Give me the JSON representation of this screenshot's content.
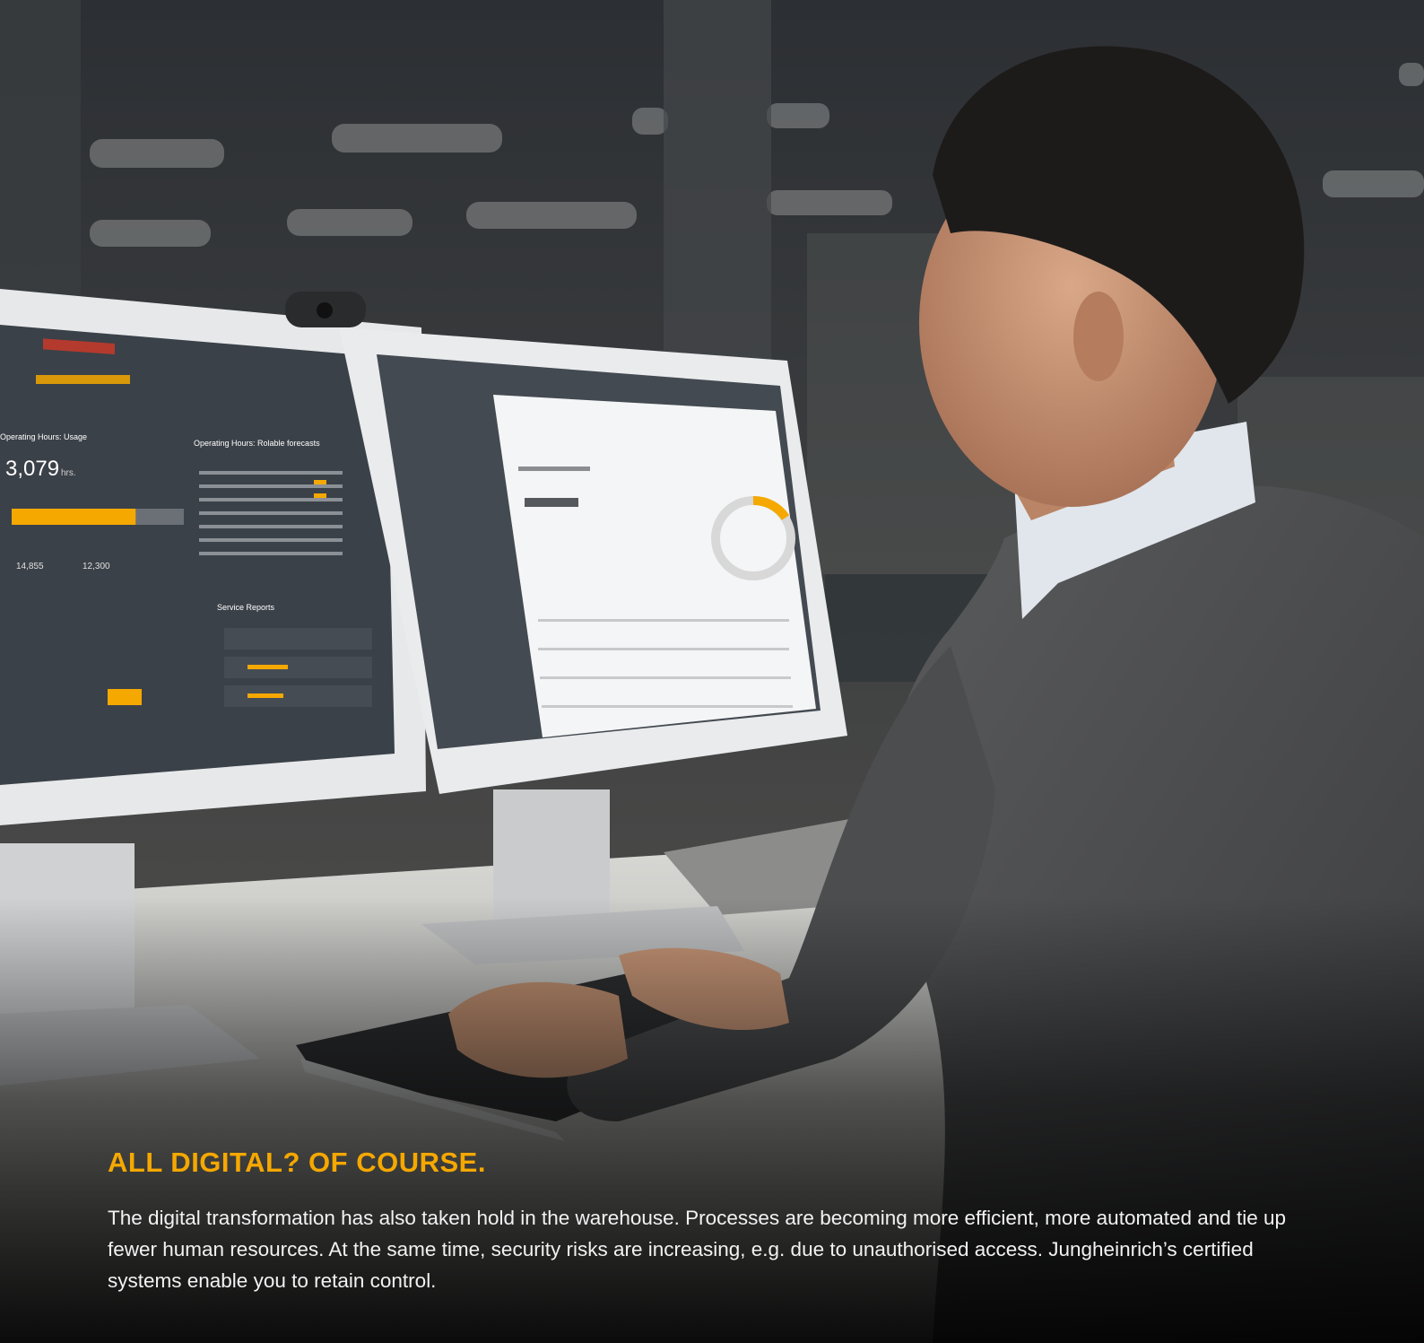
{
  "headline": "ALL DIGITAL? OF COURSE.",
  "body_text": "The digital transformation has also taken hold in the warehouse. Processes are becoming more efficient, more automated and tie up fewer human resources. At the same time, security risks are increasing, e.g. due to unauthorised access. Jungheinrich’s certified systems enable you to retain control.",
  "left_monitor": {
    "headline_value": "3,079",
    "headline_unit": "hrs.",
    "stat_a": "14,855",
    "stat_b": "12,300",
    "panel_title_1": "Operating Hours: Usage",
    "panel_title_2": "Operating Hours: Rolable forecasts",
    "section_title": "Service Reports",
    "usage_fill_fraction": 0.72
  },
  "colors": {
    "accent": "#f5a800",
    "caption_text": "#f2f2f2",
    "screen_dark": "#3b4148",
    "monitor_bezel": "#e8eaec"
  }
}
